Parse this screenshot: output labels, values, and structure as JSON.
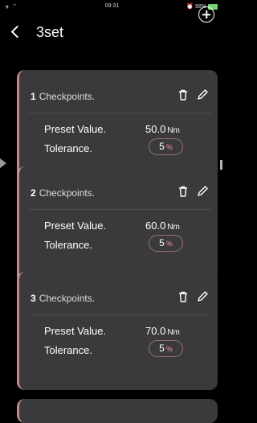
{
  "status_bar": {
    "time": "09:31",
    "battery_text": "98%",
    "left_icons": [
      "airplane-icon",
      "wifi-icon"
    ],
    "right_icons": [
      "alarm-icon",
      "battery-icon"
    ]
  },
  "header": {
    "title": "3set",
    "back_icon": "chevron-left-icon",
    "add_icon": "plus-circle-icon"
  },
  "checkpoints_label": "Checkpoints.",
  "preset_label": "Preset Value.",
  "tolerance_label": "Tolerance.",
  "unit": "Nm",
  "percent_sign": "%",
  "cards": [
    {
      "number": "1",
      "preset": "50.0",
      "tolerance": "5"
    },
    {
      "number": "2",
      "preset": "60.0",
      "tolerance": "5"
    },
    {
      "number": "3",
      "preset": "70.0",
      "tolerance": "5"
    }
  ],
  "colors": {
    "background": "#000000",
    "card_background": "#3a3a3c",
    "card_accent": "#c48a8a",
    "tolerance_border": "#9c6e6e"
  }
}
